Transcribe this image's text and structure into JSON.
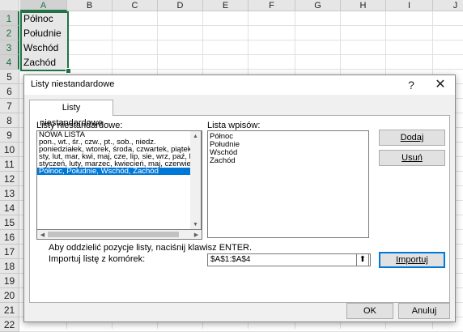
{
  "sheet": {
    "columns": [
      "A",
      "B",
      "C",
      "D",
      "E",
      "F",
      "G",
      "H",
      "I",
      "J"
    ],
    "rows": [
      "1",
      "2",
      "3",
      "4",
      "5",
      "6",
      "7",
      "8",
      "9",
      "10",
      "11",
      "12",
      "13",
      "14",
      "15",
      "16",
      "17",
      "18",
      "19",
      "20",
      "21",
      "22"
    ],
    "cells": [
      "Północ",
      "Południe",
      "Wschód",
      "Zachód"
    ]
  },
  "dialog": {
    "title": "Listy niestandardowe",
    "help": "?",
    "close": "✕",
    "tab": "Listy niestandardowe",
    "lists_label": "Listy niestandardowe:",
    "entries_label": "Lista wpisów:",
    "lists": [
      "NOWA LISTA",
      "pon., wt., śr., czw., pt., sob., niedz.",
      "poniedziałek, wtorek, środa, czwartek, piątek",
      "sty, lut, mar, kwi, maj, cze, lip, sie, wrz, paź, lis",
      "styczeń, luty, marzec, kwiecień, maj, czerwiec,",
      "Północ, Południe, Wschód, Zachód"
    ],
    "selected_list_index": 5,
    "entries": [
      "Północ",
      "Południe",
      "Wschód",
      "Zachód"
    ],
    "add_button": "Dodaj",
    "delete_button": "Usuń",
    "hint": "Aby oddzielić pozycje listy, naciśnij klawisz ENTER.",
    "import_label": "Importuj listę z komórek:",
    "import_range": "$A$1:$A$4",
    "import_button": "Importuj",
    "ok_button": "OK",
    "cancel_button": "Anuluj"
  }
}
